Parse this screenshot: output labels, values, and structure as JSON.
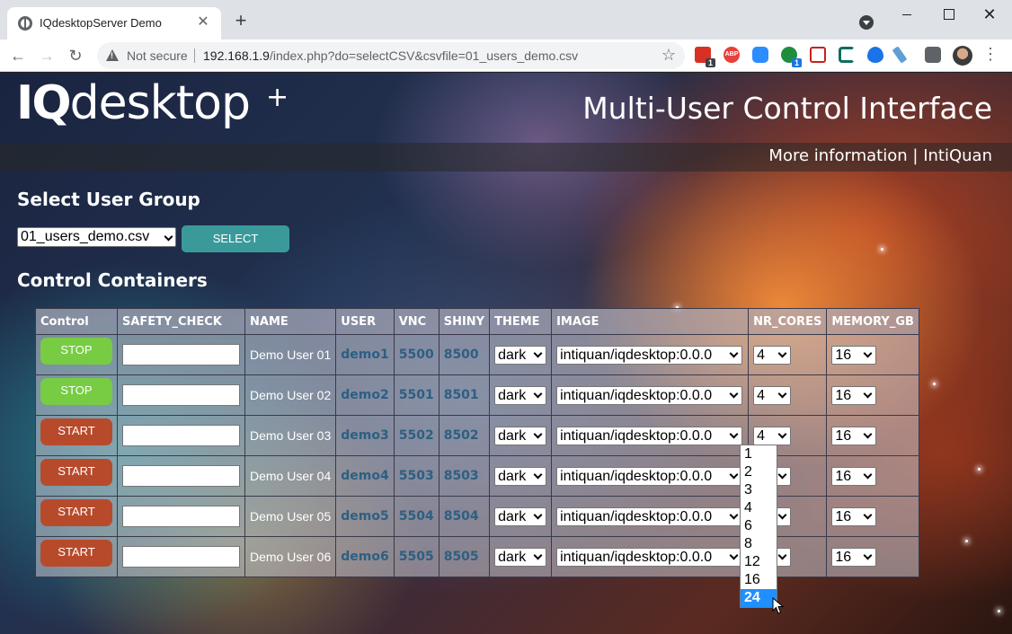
{
  "browser": {
    "tab_title": "IQdesktopServer Demo",
    "not_secure": "Not secure",
    "url_host": "192.168.1.9",
    "url_path": "/index.php?do=selectCSV&csvfile=01_users_demo.csv",
    "ext_badge_1": "1",
    "ext_badge_2": "1",
    "ext_abp": "ABP"
  },
  "header": {
    "logo_iq": "IQ",
    "logo_rest": "desktop",
    "title": "Multi-User Control Interface",
    "more_info": "More information",
    "separator": "|",
    "intiquan": "IntiQuan"
  },
  "group": {
    "heading": "Select User Group",
    "csv_value": "01_users_demo.csv",
    "select_label": "SELECT"
  },
  "control": {
    "heading": "Control Containers",
    "columns": [
      "Control",
      "SAFETY_CHECK",
      "NAME",
      "USER",
      "VNC",
      "SHINY",
      "THEME",
      "IMAGE",
      "NR_CORES",
      "MEMORY_GB"
    ],
    "rows": [
      {
        "action": "STOP",
        "name": "Demo User 01",
        "user": "demo1",
        "vnc": "5500",
        "shiny": "8500",
        "theme": "dark",
        "image": "intiquan/iqdesktop:0.0.0",
        "cores": "4",
        "memory": "16"
      },
      {
        "action": "STOP",
        "name": "Demo User 02",
        "user": "demo2",
        "vnc": "5501",
        "shiny": "8501",
        "theme": "dark",
        "image": "intiquan/iqdesktop:0.0.0",
        "cores": "4",
        "memory": "16"
      },
      {
        "action": "START",
        "name": "Demo User 03",
        "user": "demo3",
        "vnc": "5502",
        "shiny": "8502",
        "theme": "dark",
        "image": "intiquan/iqdesktop:0.0.0",
        "cores": "4",
        "memory": "16"
      },
      {
        "action": "START",
        "name": "Demo User 04",
        "user": "demo4",
        "vnc": "5503",
        "shiny": "8503",
        "theme": "dark",
        "image": "intiquan/iqdesktop:0.0.0",
        "cores": "4",
        "memory": "16"
      },
      {
        "action": "START",
        "name": "Demo User 05",
        "user": "demo5",
        "vnc": "5504",
        "shiny": "8504",
        "theme": "dark",
        "image": "intiquan/iqdesktop:0.0.0",
        "cores": "4",
        "memory": "16"
      },
      {
        "action": "START",
        "name": "Demo User 06",
        "user": "demo6",
        "vnc": "5505",
        "shiny": "8505",
        "theme": "dark",
        "image": "intiquan/iqdesktop:0.0.0",
        "cores": "4",
        "memory": "16"
      }
    ]
  },
  "cores_dropdown": {
    "options": [
      "1",
      "2",
      "3",
      "4",
      "6",
      "8",
      "12",
      "16",
      "24"
    ],
    "highlighted": "24"
  },
  "colors": {
    "stop_button": "#77cc44",
    "start_button": "#b84a2c",
    "select_button": "#3a9a9a",
    "user_text": "#2d5f82",
    "dropdown_highlight": "#1e90ff"
  }
}
